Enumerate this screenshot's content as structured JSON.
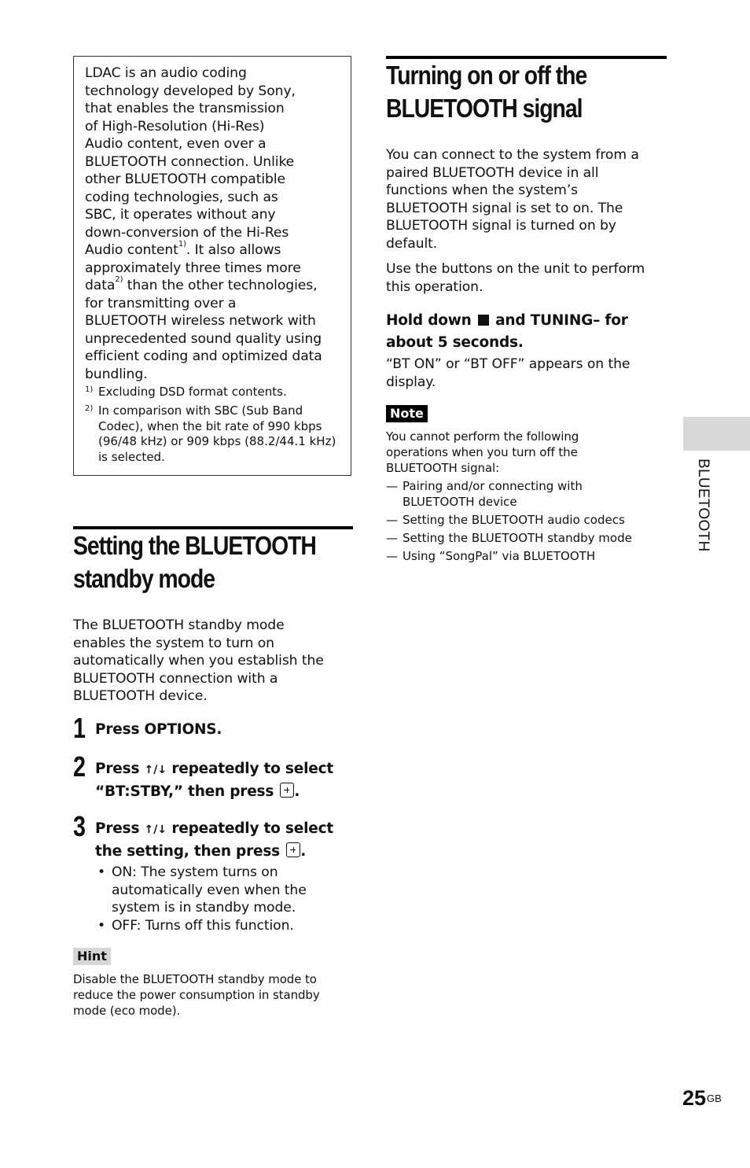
{
  "ldac_box": {
    "lines": [
      "LDAC is an audio coding",
      "technology developed by Sony,",
      "that enables the transmission",
      "of High-Resolution (Hi-Res)",
      "Audio content, even over a",
      "BLUETOOTH connection. Unlike",
      "other BLUETOOTH compatible",
      "coding technologies, such as",
      "SBC, it operates without any",
      "down-conversion of the Hi-Res"
    ],
    "line_audio_content_a": "Audio content",
    "line_audio_content_sup": "1)",
    "line_audio_content_b": ". It also allows",
    "line_approx": "approximately three times more",
    "line_data_a": "data",
    "line_data_sup": "2)",
    "line_data_b": " than the other technologies,",
    "lines_after": [
      "for transmitting over a",
      "BLUETOOTH wireless network with",
      "unprecedented sound quality using",
      "efficient coding and optimized data",
      "bundling."
    ],
    "footnotes": [
      {
        "mark": "1)",
        "text": "Excluding DSD format contents."
      },
      {
        "mark": "2)",
        "text": "In comparison with SBC (Sub Band Codec), when the bit rate of 990 kbps (96/48 kHz) or 909 kbps (88.2/44.1 kHz) is selected."
      }
    ]
  },
  "standby_section": {
    "title_line1": "Setting the BLUETOOTH",
    "title_line2": "standby mode",
    "intro": "The BLUETOOTH standby mode enables the system to turn on automatically when you establish the BLUETOOTH connection with a BLUETOOTH device.",
    "steps": [
      {
        "number": "1",
        "text": "Press OPTIONS."
      },
      {
        "number": "2",
        "text_a": "Press ",
        "arrows": "↑/↓",
        "text_b": " repeatedly to select “BT:STBY,” then press ",
        "text_c": "."
      },
      {
        "number": "3",
        "text_a": "Press ",
        "arrows": "↑/↓",
        "text_b": " repeatedly to select the setting, then press ",
        "text_c": "."
      }
    ],
    "options": [
      "ON: The system turns on automatically even when the system is in standby mode.",
      "OFF: Turns off this function."
    ],
    "hint_label": "Hint",
    "hint_text": "Disable the BLUETOOTH standby mode to reduce the power consumption in standby mode (eco mode)."
  },
  "signal_section": {
    "title_line1": "Turning on or off the",
    "title_line2": "BLUETOOTH signal",
    "intro": "You can connect to the system from a paired BLUETOOTH device in all functions when the system’s BLUETOOTH signal is set to on. The BLUETOOTH signal is turned on by default.",
    "intro2": "Use the buttons on the unit to perform this operation.",
    "instruction_a": "Hold down ",
    "instruction_b": " and TUNING– for about 5 seconds.",
    "result": "“BT ON” or “BT OFF” appears on the display.",
    "note_label": "Note",
    "note_text": "You cannot perform the following operations when you turn off the BLUETOOTH signal:",
    "note_items": [
      "Pairing and/or connecting with BLUETOOTH device",
      "Setting the BLUETOOTH audio codecs",
      "Setting the BLUETOOTH standby mode",
      "Using “SongPal” via BLUETOOTH"
    ]
  },
  "side_tab": {
    "label": "BLUETOOTH"
  },
  "page_number": {
    "number": "25",
    "suffix": "GB"
  }
}
